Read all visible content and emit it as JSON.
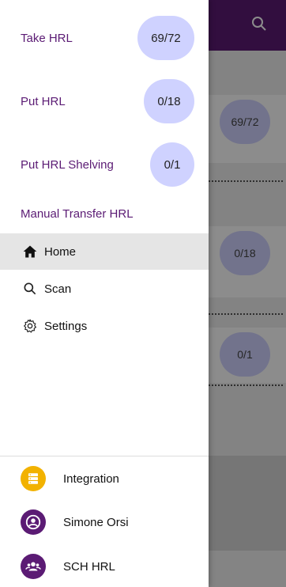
{
  "colors": {
    "brand": "#5b1b74",
    "pill": "#cfd2ff",
    "integration": "#f2b200"
  },
  "drawer": {
    "tasks": [
      {
        "label": "Take HRL",
        "count": "69/72"
      },
      {
        "label": "Put HRL",
        "count": "0/18"
      },
      {
        "label": "Put HRL Shelving",
        "count": "0/1"
      },
      {
        "label": "Manual Transfer HRL"
      }
    ],
    "nav": [
      {
        "label": "Home",
        "icon": "home-icon",
        "active": true
      },
      {
        "label": "Scan",
        "icon": "search-icon"
      },
      {
        "label": "Settings",
        "icon": "gear-icon"
      }
    ],
    "footer": [
      {
        "label": "Integration",
        "icon": "server-icon"
      },
      {
        "label": "Simone Orsi",
        "icon": "account-icon"
      },
      {
        "label": "SCH HRL",
        "icon": "group-icon"
      }
    ]
  },
  "background": {
    "counts": [
      "69/72",
      "0/18",
      "0/1"
    ]
  }
}
